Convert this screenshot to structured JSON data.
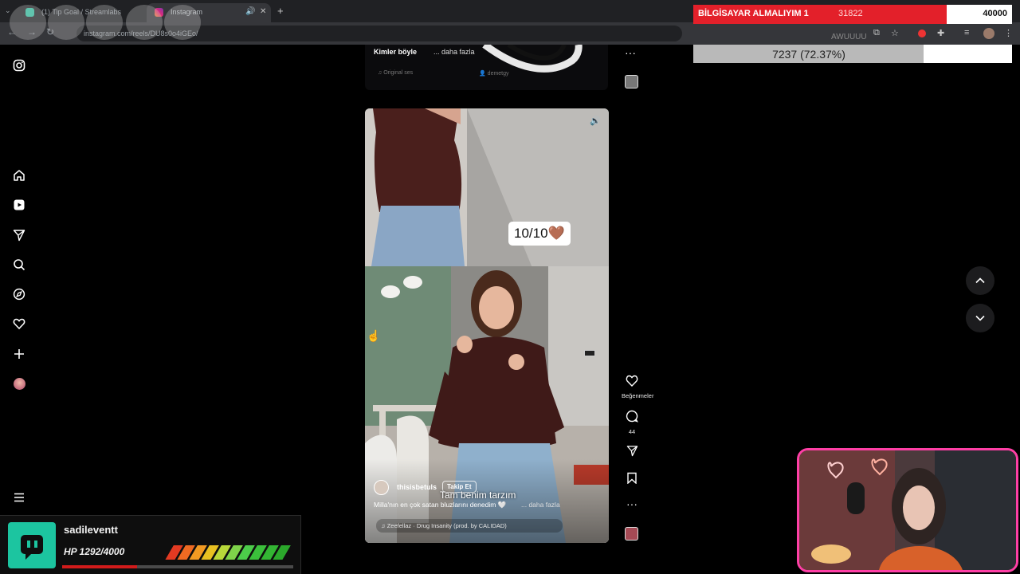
{
  "browser": {
    "tabs": [
      {
        "label": "(1) Tip Goal / Streamlabs",
        "active": false
      },
      {
        "label": "Instagram",
        "active": true
      }
    ],
    "new_tab_label": "+",
    "url": "instagram.com/reels/DU8s0o4iGEo/"
  },
  "goal_overlay": {
    "title": "BİLGİSAYAR ALMALIYIM 1",
    "current": "31822",
    "target": "40000",
    "progress": 0.7956,
    "second_bar_text": "7237 (72.37%)",
    "second_progress": 0.7237,
    "ghost_text": "AWUUUU"
  },
  "instagram_nav": {
    "items": [
      {
        "name": "instagram-logo-icon"
      },
      {
        "name": "home-icon"
      },
      {
        "name": "reels-icon"
      },
      {
        "name": "messages-icon"
      },
      {
        "name": "search-icon"
      },
      {
        "name": "explore-icon"
      },
      {
        "name": "notifications-icon"
      },
      {
        "name": "create-icon"
      },
      {
        "name": "profile-avatar"
      },
      {
        "name": "more-menu-icon"
      }
    ]
  },
  "prev_reel": {
    "caption": "Kimler böyle",
    "more": "... daha fazla",
    "audio": "Original ses",
    "tag": "demetgy"
  },
  "reel": {
    "sticker": "10/10🤎",
    "subtitle": "Tam benim tarzım",
    "username": "thisisbetuls",
    "follow_label": "Takip Et",
    "caption": "Milla'nın en çok satan bluzlarını denedim 🤍",
    "more": "... daha fazla",
    "audio": "Zeefellaz · Drug Insanity (prod. by CALIDAD)"
  },
  "reel_actions": {
    "likes_label": "Beğenmeler",
    "comments_count": "44"
  },
  "stream_widget": {
    "name": "sadileventt",
    "hp_text": "HP 1292/4000",
    "hp_fraction": 0.323
  },
  "colors": {
    "goal_red": "#e3202a",
    "webcam_border": "#ff3fa6",
    "widget_teal": "#1cc5a0"
  }
}
